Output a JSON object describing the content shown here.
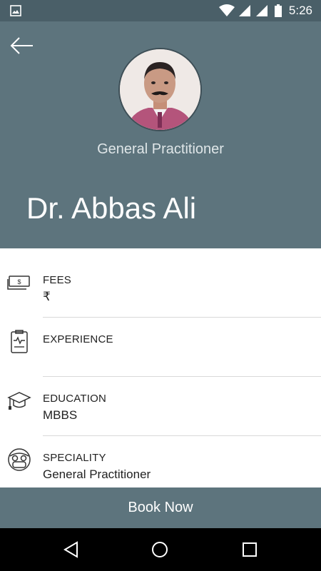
{
  "status_bar": {
    "time": "5:26",
    "icons": [
      "image-notification-icon",
      "wifi-icon",
      "signal-icon",
      "signal-icon",
      "battery-icon"
    ]
  },
  "header": {
    "back_icon": "arrow-left-icon",
    "specialty": "General Practitioner",
    "doctor_name": "Dr. Abbas Ali",
    "background": "#5d747d"
  },
  "details": [
    {
      "icon": "cash-icon",
      "label": "FEES",
      "value": "₹"
    },
    {
      "icon": "clipboard-icon",
      "label": "EXPERIENCE",
      "value": ""
    },
    {
      "icon": "graduation-cap-icon",
      "label": "EDUCATION",
      "value": "MBBS"
    },
    {
      "icon": "doctor-mask-icon",
      "label": "SPECIALITY",
      "value": "General Practitioner"
    }
  ],
  "book_button": {
    "label": "Book Now"
  },
  "nav_bar": {
    "icons": [
      "back-triangle-icon",
      "home-circle-icon",
      "recents-square-icon"
    ]
  },
  "colors": {
    "accent": "#5d747d",
    "status_bar": "#4a5f68",
    "nav_bar": "#000000"
  }
}
